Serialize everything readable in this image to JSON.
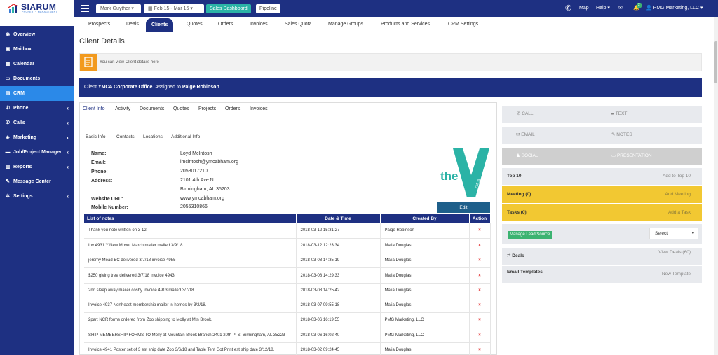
{
  "topbar": {
    "logo": "SIARUM",
    "logo_sub": "PROPERTY MANAGEMENT",
    "user_select": "Mark Guyther",
    "date_range": "Feb 15 - Mar 16",
    "dashboard_button": "Sales Dashboard",
    "pipeline_button": "Pipeline",
    "map": "Map",
    "help": "Help",
    "notification_count": "2",
    "account": "PMG Marketing, LLC"
  },
  "nav_tabs": [
    "Prospects",
    "Deals",
    "Clients",
    "Quotes",
    "Orders",
    "Invoices",
    "Sales Quota",
    "Manage Groups",
    "Products and Services",
    "CRM Settings"
  ],
  "sidebar": [
    {
      "label": "Overview",
      "icon": "dashboard-icon"
    },
    {
      "label": "Mailbox",
      "icon": "mailbox-icon"
    },
    {
      "label": "Calendar",
      "icon": "calendar-icon"
    },
    {
      "label": "Documents",
      "icon": "documents-icon"
    },
    {
      "label": "CRM",
      "icon": "crm-icon"
    },
    {
      "label": "Phone",
      "icon": "phone-icon"
    },
    {
      "label": "Calls",
      "icon": "calls-icon"
    },
    {
      "label": "Marketing",
      "icon": "marketing-icon"
    },
    {
      "label": "Job/Project Manager",
      "icon": "briefcase-icon"
    },
    {
      "label": "Reports",
      "icon": "reports-icon"
    },
    {
      "label": "Message Center",
      "icon": "message-icon"
    },
    {
      "label": "Settings",
      "icon": "gear-icon"
    }
  ],
  "page_title": "Client Details",
  "info_text": "You can view Client details here",
  "client_header": {
    "client_label": "Client",
    "client_name": "YMCA Corporate Office",
    "assigned_label": "Assigned to",
    "assigned_name": "Paige Robinson"
  },
  "subtabs": [
    "Client Info",
    "Activity",
    "Documents",
    "Quotes",
    "Projects",
    "Orders",
    "Invoices"
  ],
  "inner_tabs": [
    "Basic Info",
    "Contacts",
    "Locations",
    "Additional Info"
  ],
  "basic_info": {
    "name_label": "Name:",
    "name": "Loyd McIntosh",
    "email_label": "Email:",
    "email": "lmcintosh@ymcabham.org",
    "phone_label": "Phone:",
    "phone": "2058017210",
    "address_label": "Address:",
    "address_line1": "2101 4th Ave N",
    "address_line2": "Birmingham, AL 35203",
    "website_label": "Website URL:",
    "website": "www.ymcabham.org",
    "mobile_label": "Mobile Number:",
    "mobile": "2055310866"
  },
  "logo_text": "the",
  "logo_y_text": "YMCA",
  "edit_button": "Edit",
  "notes_table": {
    "headers": [
      "List of notes",
      "Date & Time",
      "Created By",
      "Action"
    ],
    "rows": [
      [
        "Thank you note written on 3-12",
        "2018-03-12 15:31:27",
        "Paige Robinson",
        "×"
      ],
      [
        "Inv 4931 Y New Mover March mailer mailed 3/9/18.",
        "2018-03-12 12:23:34",
        "Malia Douglas",
        "×"
      ],
      [
        "jeremy Mead BC delivered 3/7/18 invoice 4955",
        "2018-03-08 14:35:19",
        "Malia Douglas",
        "×"
      ],
      [
        "$250 giving tree delivered 3/7/18 Invoice 4943",
        "2018-03-08 14:29:33",
        "Malia Douglas",
        "×"
      ],
      [
        "2nd sleep away mailer cosby Invoice 4913 mailed 3/7/18",
        "2018-03-08 14:25:42",
        "Malia Douglas",
        "×"
      ],
      [
        "Invoice 4937 Northeast membership mailer in homes by 3/2/18.",
        "2018-03-07 09:55:18",
        "Malia Douglas",
        "×"
      ],
      [
        "2part NCR forms ordered from Zoo shipping to Molly at Mtn Brook.",
        "2018-03-06 16:19:55",
        "PMG Marketing, LLC",
        "×"
      ],
      [
        "SHIP MEMBERSHIP FORMS TO Molly at Mountain Brook Branch 2401 20th Pl S, Birmingham, AL 35223",
        "2018-03-06 16:02:40",
        "PMG Marketing, LLC",
        "×"
      ],
      [
        "Invoice 4941 Poster set of 3 est ship date Zoo 3/6/18 and Table Tent Got Print est ship date 3/12/18.",
        "2018-03-02 09:24:45",
        "Malia Douglas",
        "×"
      ]
    ]
  },
  "right_panel": {
    "call": "CALL",
    "text": "TEXT",
    "email": "EMAIL",
    "notes": "NOTES",
    "social": "SOCIAL",
    "presentation": "PRESENTATION",
    "top10_label": "Top 10",
    "top10_action": "Add to Top 10",
    "meeting_label": "Meeting (0)",
    "meeting_action": "Add Meeting",
    "tasks_label": "Tasks (0)",
    "tasks_action": "Add a Task",
    "lead_source": "Manage Lead Source",
    "select_value": "Select",
    "deals_label": "Deals",
    "deals_action": "View Deals (60)",
    "email_templates_label": "Email Templates",
    "email_templates_action": "New Template"
  },
  "colors": {
    "navy": "#1e3082",
    "accent_blue": "#2b89e8",
    "yellow": "#f2c832",
    "orange": "#f29a1e",
    "green": "#3cb371",
    "delete_red": "#e02020",
    "ymca_teal": "#2bb3a6"
  }
}
